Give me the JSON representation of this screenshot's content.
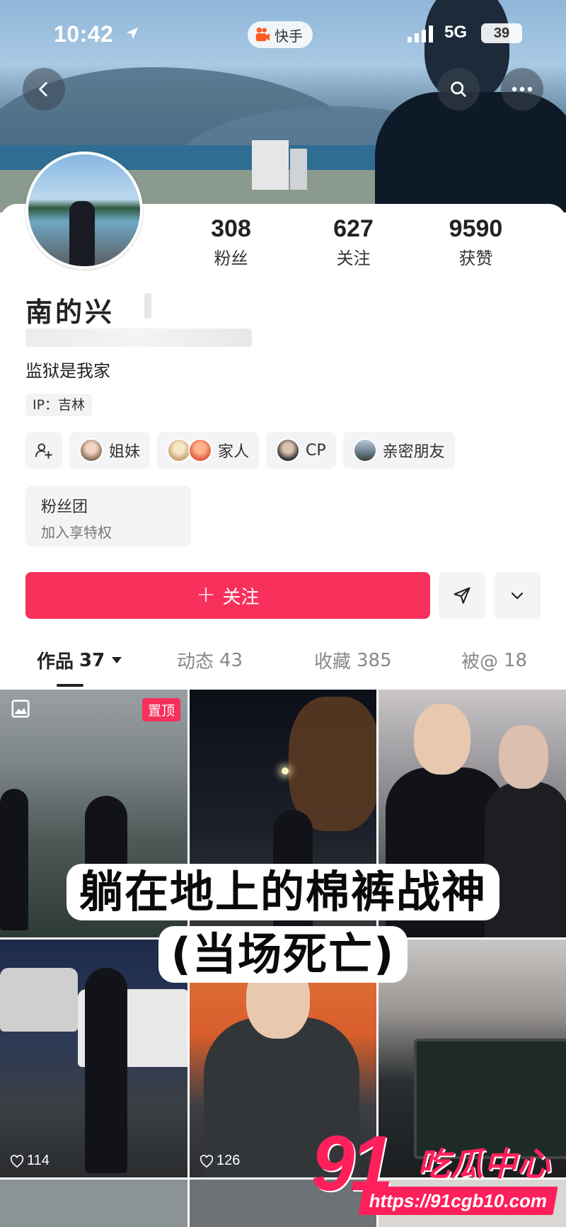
{
  "status_bar": {
    "time": "10:42",
    "network": "5G",
    "battery": "39",
    "app_pill": "快手"
  },
  "profile": {
    "stats": [
      {
        "value": "308",
        "label": "粉丝"
      },
      {
        "value": "627",
        "label": "关注"
      },
      {
        "value": "9590",
        "label": "获赞"
      }
    ],
    "name": "南的兴",
    "bio": "监狱是我家",
    "ip": "IP：吉林",
    "relations": [
      {
        "label": "姐妹"
      },
      {
        "label": "家人"
      },
      {
        "label": "CP"
      },
      {
        "label": "亲密朋友"
      }
    ],
    "fans_group": {
      "title": "粉丝团",
      "subtitle": "加入享特权"
    },
    "follow_label": "关注"
  },
  "tabs": [
    {
      "label": "作品",
      "count": "37"
    },
    {
      "label": "动态",
      "count": "43"
    },
    {
      "label": "收藏",
      "count": "385"
    },
    {
      "label": "被@",
      "count": "18"
    }
  ],
  "grid": {
    "pin_badge": "置顶",
    "likes": [
      "114",
      "126"
    ]
  },
  "caption": {
    "line1": "躺在地上的棉裤战神",
    "line2": "(当场死亡)"
  },
  "watermark": {
    "number": "91",
    "name": "吃瓜中心",
    "url": "https://91cgb10.com"
  },
  "colors": {
    "accent": "#f7305c",
    "watermark": "#ff1f5a"
  }
}
